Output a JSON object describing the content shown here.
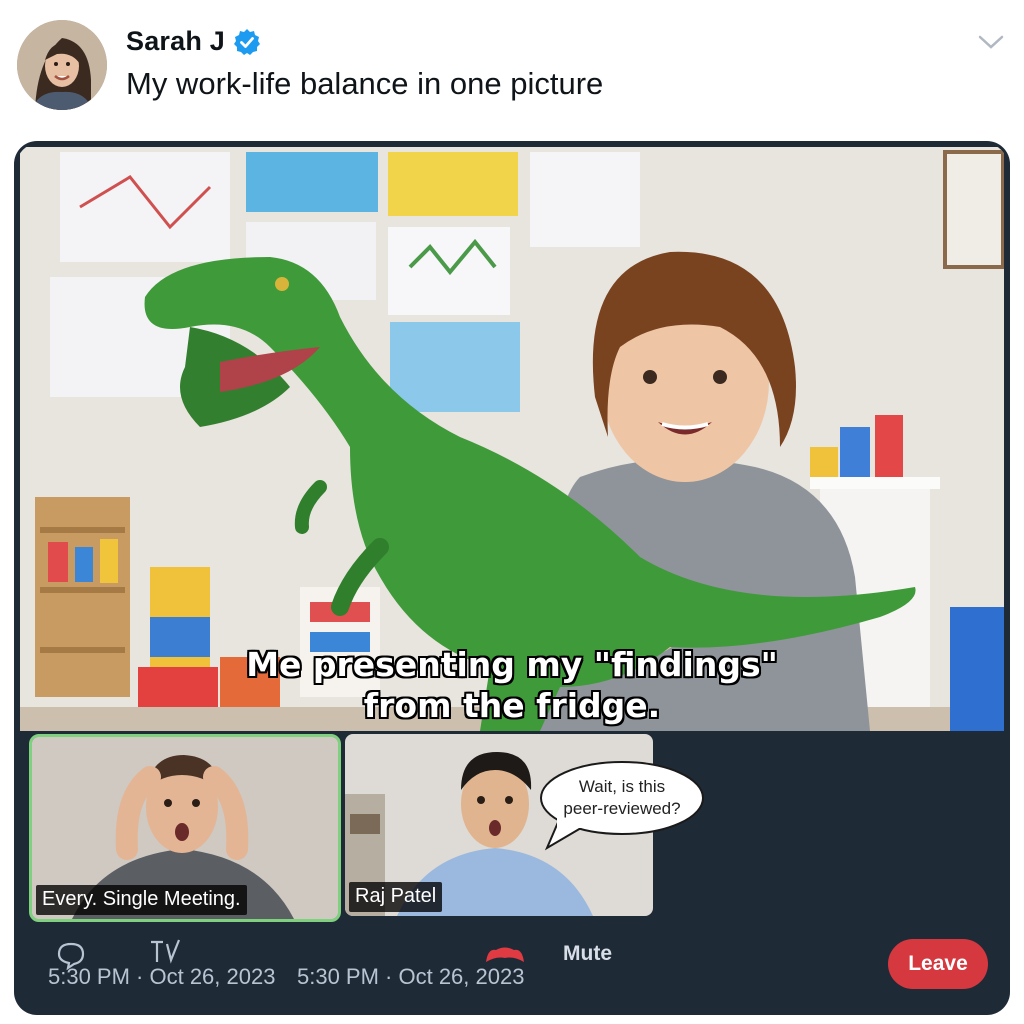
{
  "tweet": {
    "author_name": "Sarah J",
    "verified_icon": "verified-badge-icon",
    "text": "My work-life balance in one picture",
    "more_icon": "chevron-down-icon"
  },
  "meme": {
    "caption_line1": "Me presenting my \"findings\"",
    "caption_line2": "from the fridge."
  },
  "call": {
    "tiles": [
      {
        "label": "Every. Single Meeting.",
        "active_speaker": true
      },
      {
        "label": "Raj Patel",
        "speech_bubble": [
          "Wait, is this",
          "peer-reviewed?"
        ]
      }
    ],
    "timestamps": [
      "5:30 PM · Oct 26, 2023",
      "5:30 PM · Oct 26, 2023"
    ],
    "mute_label": "Mute",
    "leave_label": "Leave",
    "icons": [
      "reply-icon",
      "retweet-icon",
      "mute-mic-icon"
    ]
  },
  "colors": {
    "verified_blue": "#1d9bf0",
    "call_background": "#1f2a37",
    "leave_red": "#d6383f",
    "active_speaker_border": "#7fd07f"
  }
}
